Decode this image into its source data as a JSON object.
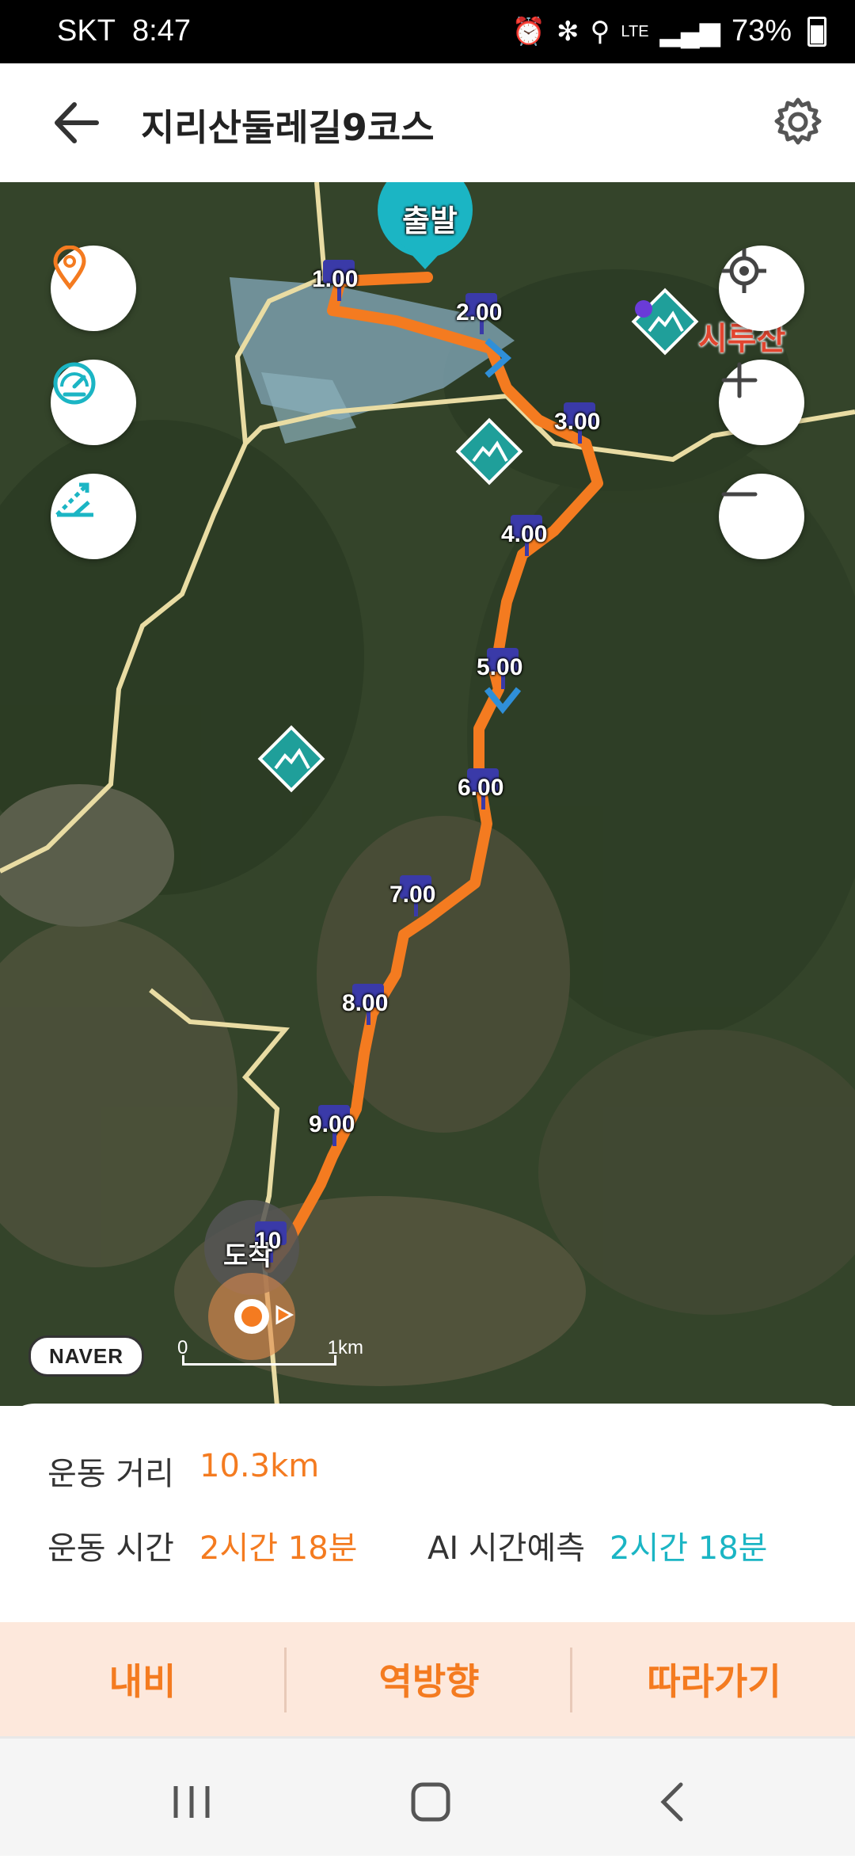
{
  "status_bar": {
    "carrier": "SKT",
    "time": "8:47",
    "network": "LTE",
    "battery": "73%",
    "icons": [
      "alarm-icon",
      "bluetooth-icon",
      "location-icon",
      "lte-icon",
      "signal-icon",
      "battery-icon"
    ]
  },
  "header": {
    "title": "지리산둘레길9코스",
    "back_icon": "arrow-left-icon",
    "settings_icon": "gear-icon"
  },
  "map": {
    "start_pin": "출발",
    "end_label": "도착",
    "peak_label": "시루산",
    "provider": "NAVER",
    "scale_start": "0",
    "scale_end": "1km",
    "km_markers": [
      "1.00",
      "2.00",
      "3.00",
      "4.00",
      "5.00",
      "6.00",
      "7.00",
      "8.00",
      "9.00",
      "10"
    ],
    "route_color": "#f47b20",
    "marker_color": "#3a3aa8",
    "left_controls": [
      "location-pin-icon",
      "speedometer-icon",
      "elevation-icon"
    ],
    "right_controls": [
      "crosshair-icon",
      "plus-icon",
      "minus-icon"
    ]
  },
  "stats": {
    "distance_label": "운동 거리",
    "distance_value": "10.3km",
    "time_label": "운동 시간",
    "time_value": "2시간 18분",
    "ai_label": "AI 시간예측",
    "ai_value": "2시간 18분"
  },
  "actions": {
    "navi": "내비",
    "reverse": "역방향",
    "follow": "따라가기"
  },
  "colors": {
    "accent": "#f47b20",
    "teal": "#1bb5c4",
    "action_bg": "#fde8dc"
  }
}
